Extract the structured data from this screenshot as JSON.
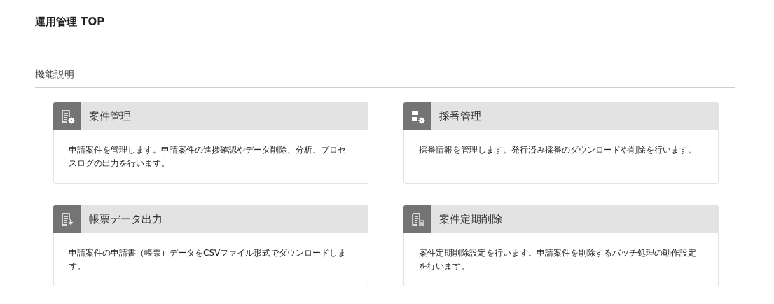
{
  "page": {
    "title": "運用管理 TOP"
  },
  "section": {
    "title": "機能説明"
  },
  "cards": [
    {
      "kind": "document-gear",
      "title": "案件管理",
      "description": "申請案件を管理します。申請案件の進捗確認やデータ削除、分析、プロセスログの出力を行います。"
    },
    {
      "kind": "numbering-gear",
      "title": "採番管理",
      "description": "採番情報を管理します。発行済み採番のダウンロードや削除を行います。"
    },
    {
      "kind": "document-download",
      "title": "帳票データ出力",
      "description": "申請案件の申請書（帳票）データをCSVファイル形式でダウンロードします。"
    },
    {
      "kind": "document-trash",
      "title": "案件定期削除",
      "description": "案件定期削除設定を行います。申請案件を削除するバッチ処理の動作設定を行います。"
    }
  ]
}
